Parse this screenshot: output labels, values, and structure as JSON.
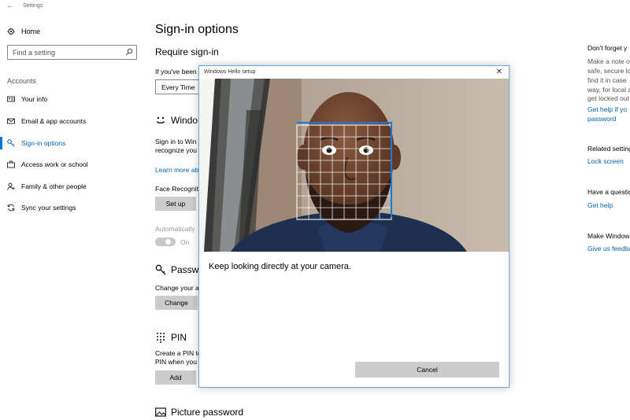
{
  "window": {
    "title": "Settings",
    "back_glyph": "←"
  },
  "sidebar": {
    "home_label": "Home",
    "search_placeholder": "Find a setting",
    "section_label": "Accounts",
    "items": [
      {
        "label": "Your info",
        "icon": "person-card-icon"
      },
      {
        "label": "Email & app accounts",
        "icon": "mail-icon"
      },
      {
        "label": "Sign-in options",
        "icon": "key-icon",
        "active": true
      },
      {
        "label": "Access work or school",
        "icon": "briefcase-icon"
      },
      {
        "label": "Family & other people",
        "icon": "person-add-icon"
      },
      {
        "label": "Sync your settings",
        "icon": "sync-icon"
      }
    ]
  },
  "main": {
    "title": "Sign-in options",
    "require_signin": {
      "heading": "Require sign-in",
      "text": "If you've been",
      "dropdown_value": "Every Time"
    },
    "hello": {
      "heading": "Windo",
      "text_line1": "Sign in to Win",
      "text_line2": "recognize you",
      "learn_more": "Learn more ab",
      "face_label": "Face Recogniti",
      "setup_button": "Set up",
      "auto_label": "Automatically",
      "toggle_state": "On"
    },
    "password": {
      "heading": "Passwo",
      "text": "Change your a",
      "button": "Change"
    },
    "pin": {
      "heading": "PIN",
      "text_line1": "Create a PIN to",
      "text_line2": "PIN when you",
      "button": "Add"
    },
    "picture_password": {
      "heading": "Picture password"
    }
  },
  "right_panel": {
    "dont_forget": {
      "heading": "Don't forget y",
      "lines": [
        "Make a note o",
        "safe, secure lo",
        "find it in case",
        "way, for local a",
        "get locked out"
      ],
      "link_line1": "Get help if yo",
      "link_line2": "password"
    },
    "related": {
      "heading": "Related setting",
      "link": "Lock screen"
    },
    "question": {
      "heading": "Have a questio",
      "link": "Get help"
    },
    "feedback": {
      "heading": "Make Window",
      "link": "Give us feedba"
    }
  },
  "dialog": {
    "title": "Windows Hello setup",
    "close_glyph": "✕",
    "instruction": "Keep looking directly at your camera.",
    "cancel_label": "Cancel"
  },
  "colors": {
    "accent": "#0078d7",
    "link": "#0063b1",
    "button": "#cccccc"
  }
}
